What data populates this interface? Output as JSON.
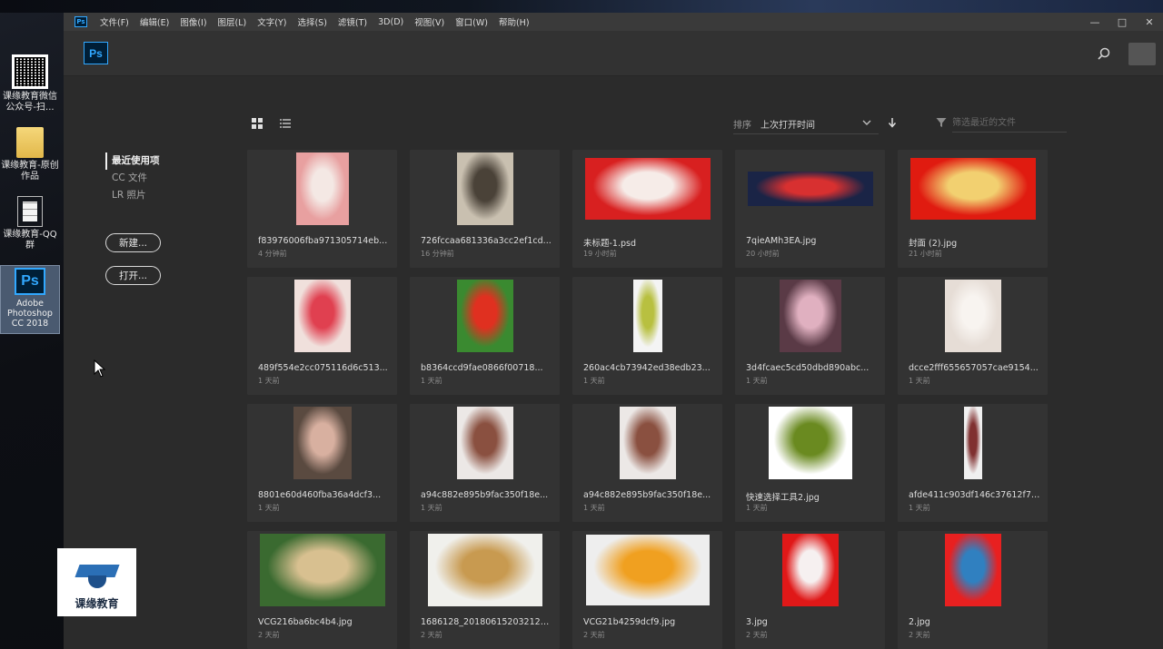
{
  "desktop": {
    "icons": [
      {
        "label": "课缘教育微信公众号-扫...",
        "icon": "qr-code-icon"
      },
      {
        "label": "课缘教育-原创作品",
        "icon": "folder-icon"
      },
      {
        "label": "课缘教育-QQ群",
        "icon": "document-icon"
      },
      {
        "label": "Adobe Photoshop CC 2018",
        "icon": "photoshop-icon"
      }
    ],
    "brand_text": "课缘教育"
  },
  "menubar": {
    "app_icon": "Ps",
    "items": [
      "文件(F)",
      "编辑(E)",
      "图像(I)",
      "图层(L)",
      "文字(Y)",
      "选择(S)",
      "滤镜(T)",
      "3D(D)",
      "视图(V)",
      "窗口(W)",
      "帮助(H)"
    ],
    "minimize": "—",
    "restore": "□",
    "close": "✕"
  },
  "topbar": {
    "logo": "Ps"
  },
  "sidebar": {
    "links": [
      "最近使用项",
      "CC 文件",
      "LR 照片"
    ],
    "new_button": "新建...",
    "open_button": "打开..."
  },
  "toolbar": {
    "sort_label": "排序",
    "sort_value": "上次打开时间",
    "filter_placeholder": "筛选最近的文件"
  },
  "files": [
    {
      "name": "f83976006fba971305714eb...",
      "time": "4 分钟前",
      "thumb": {
        "w": 58,
        "h": 80,
        "bg": "#e8a0a0",
        "fg": "#f4e8e4"
      }
    },
    {
      "name": "726fccaa681336a3cc2ef1cd...",
      "time": "16 分钟前",
      "thumb": {
        "w": 62,
        "h": 80,
        "bg": "#c9c0b0",
        "fg": "#4a4238"
      }
    },
    {
      "name": "未标题-1.psd",
      "time": "19 小时前",
      "thumb": {
        "w": 138,
        "h": 68,
        "bg": "#d82020",
        "fg": "#f6ece8"
      }
    },
    {
      "name": "7qieAMh3EA.jpg",
      "time": "20 小时前",
      "thumb": {
        "w": 138,
        "h": 38,
        "bg": "#1a2446",
        "fg": "#d83030"
      }
    },
    {
      "name": "封面 (2).jpg",
      "time": "21 小时前",
      "thumb": {
        "w": 138,
        "h": 68,
        "bg": "#e01b10",
        "fg": "#f2d070"
      }
    },
    {
      "name": "489f554e2cc075116d6c513...",
      "time": "1 天前",
      "thumb": {
        "w": 62,
        "h": 80,
        "bg": "#f0e0dc",
        "fg": "#e04050"
      }
    },
    {
      "name": "b8364ccd9fae0866f00718...",
      "time": "1 天前",
      "thumb": {
        "w": 62,
        "h": 80,
        "bg": "#3a8a30",
        "fg": "#e03020"
      }
    },
    {
      "name": "260ac4cb73942ed38edb23...",
      "time": "1 天前",
      "thumb": {
        "w": 32,
        "h": 80,
        "bg": "#f4f4f4",
        "fg": "#b8c040"
      }
    },
    {
      "name": "3d4fcaec5cd50dbd890abc...",
      "time": "1 天前",
      "thumb": {
        "w": 68,
        "h": 80,
        "bg": "#5a3a46",
        "fg": "#e0b0c0"
      }
    },
    {
      "name": "dcce2fff655657057cae9154...",
      "time": "1 天前",
      "thumb": {
        "w": 62,
        "h": 80,
        "bg": "#e6ddd6",
        "fg": "#f8f4f0"
      }
    },
    {
      "name": "8801e60d460fba36a4dcf3...",
      "time": "1 天前",
      "thumb": {
        "w": 64,
        "h": 80,
        "bg": "#5a4a40",
        "fg": "#d8b0a0"
      }
    },
    {
      "name": "a94c882e895b9fac350f18e...",
      "time": "1 天前",
      "thumb": {
        "w": 62,
        "h": 80,
        "bg": "#ece8e6",
        "fg": "#8a5040"
      }
    },
    {
      "name": "a94c882e895b9fac350f18e...",
      "time": "1 天前",
      "thumb": {
        "w": 62,
        "h": 80,
        "bg": "#ece8e6",
        "fg": "#8a5040"
      }
    },
    {
      "name": "快速选择工具2.jpg",
      "time": "1 天前",
      "thumb": {
        "w": 92,
        "h": 80,
        "bg": "#ffffff",
        "fg": "#6a8a20"
      }
    },
    {
      "name": "afde411c903df146c37612f7d...",
      "time": "1 天前",
      "thumb": {
        "w": 20,
        "h": 80,
        "bg": "#f0f0f0",
        "fg": "#803030"
      }
    },
    {
      "name": "VCG216ba6bc4b4.jpg",
      "time": "2 天前",
      "thumb": {
        "w": 138,
        "h": 80,
        "bg": "#3a6a30",
        "fg": "#d8c090"
      }
    },
    {
      "name": "1686128_201806152032120...",
      "time": "2 天前",
      "thumb": {
        "w": 126,
        "h": 80,
        "bg": "#f0f0ec",
        "fg": "#c89a50"
      }
    },
    {
      "name": "VCG21b4259dcf9.jpg",
      "time": "2 天前",
      "thumb": {
        "w": 136,
        "h": 78,
        "bg": "#eeeeee",
        "fg": "#f0a020"
      }
    },
    {
      "name": "3.jpg",
      "time": "2 天前",
      "thumb": {
        "w": 62,
        "h": 80,
        "bg": "#e01818",
        "fg": "#f6f0f0"
      }
    },
    {
      "name": "2.jpg",
      "time": "2 天前",
      "thumb": {
        "w": 62,
        "h": 80,
        "bg": "#e82020",
        "fg": "#3080c0"
      }
    }
  ],
  "colors": {
    "accent": "#31a8ff",
    "panel": "#2b2b2b",
    "card": "#333333"
  }
}
